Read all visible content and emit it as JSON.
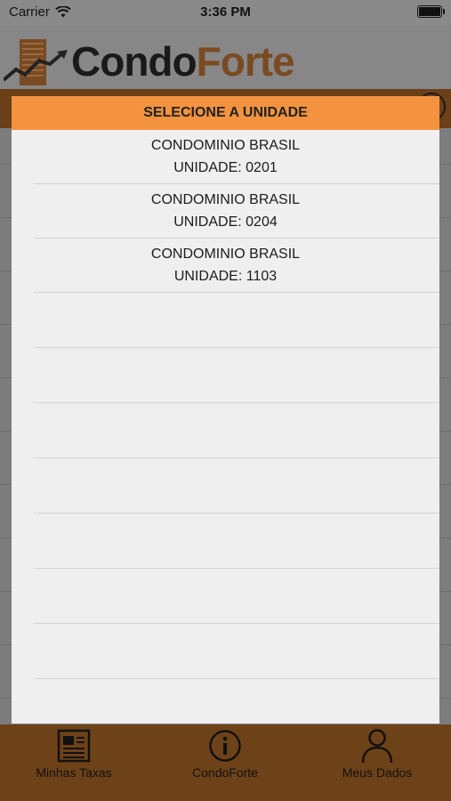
{
  "status_bar": {
    "carrier": "Carrier",
    "time": "3:36 PM",
    "battery_level": 1.0
  },
  "header": {
    "logo_part1": "Condo",
    "logo_part2": "Forte"
  },
  "modal": {
    "title": "SELECIONE A UNIDADE",
    "units": [
      {
        "condominium": "CONDOMINIO BRASIL",
        "unit": "UNIDADE: 0201"
      },
      {
        "condominium": "CONDOMINIO BRASIL",
        "unit": "UNIDADE: 0204"
      },
      {
        "condominium": "CONDOMINIO BRASIL",
        "unit": "UNIDADE: 1103"
      }
    ]
  },
  "tabbar": {
    "tabs": [
      {
        "label": "Minhas Taxas",
        "icon": "document-icon"
      },
      {
        "label": "CondoForte",
        "icon": "info-icon"
      },
      {
        "label": "Meus Dados",
        "icon": "person-icon"
      }
    ]
  },
  "colors": {
    "accent": "#f3933f",
    "brand_brown": "#6e4218"
  }
}
